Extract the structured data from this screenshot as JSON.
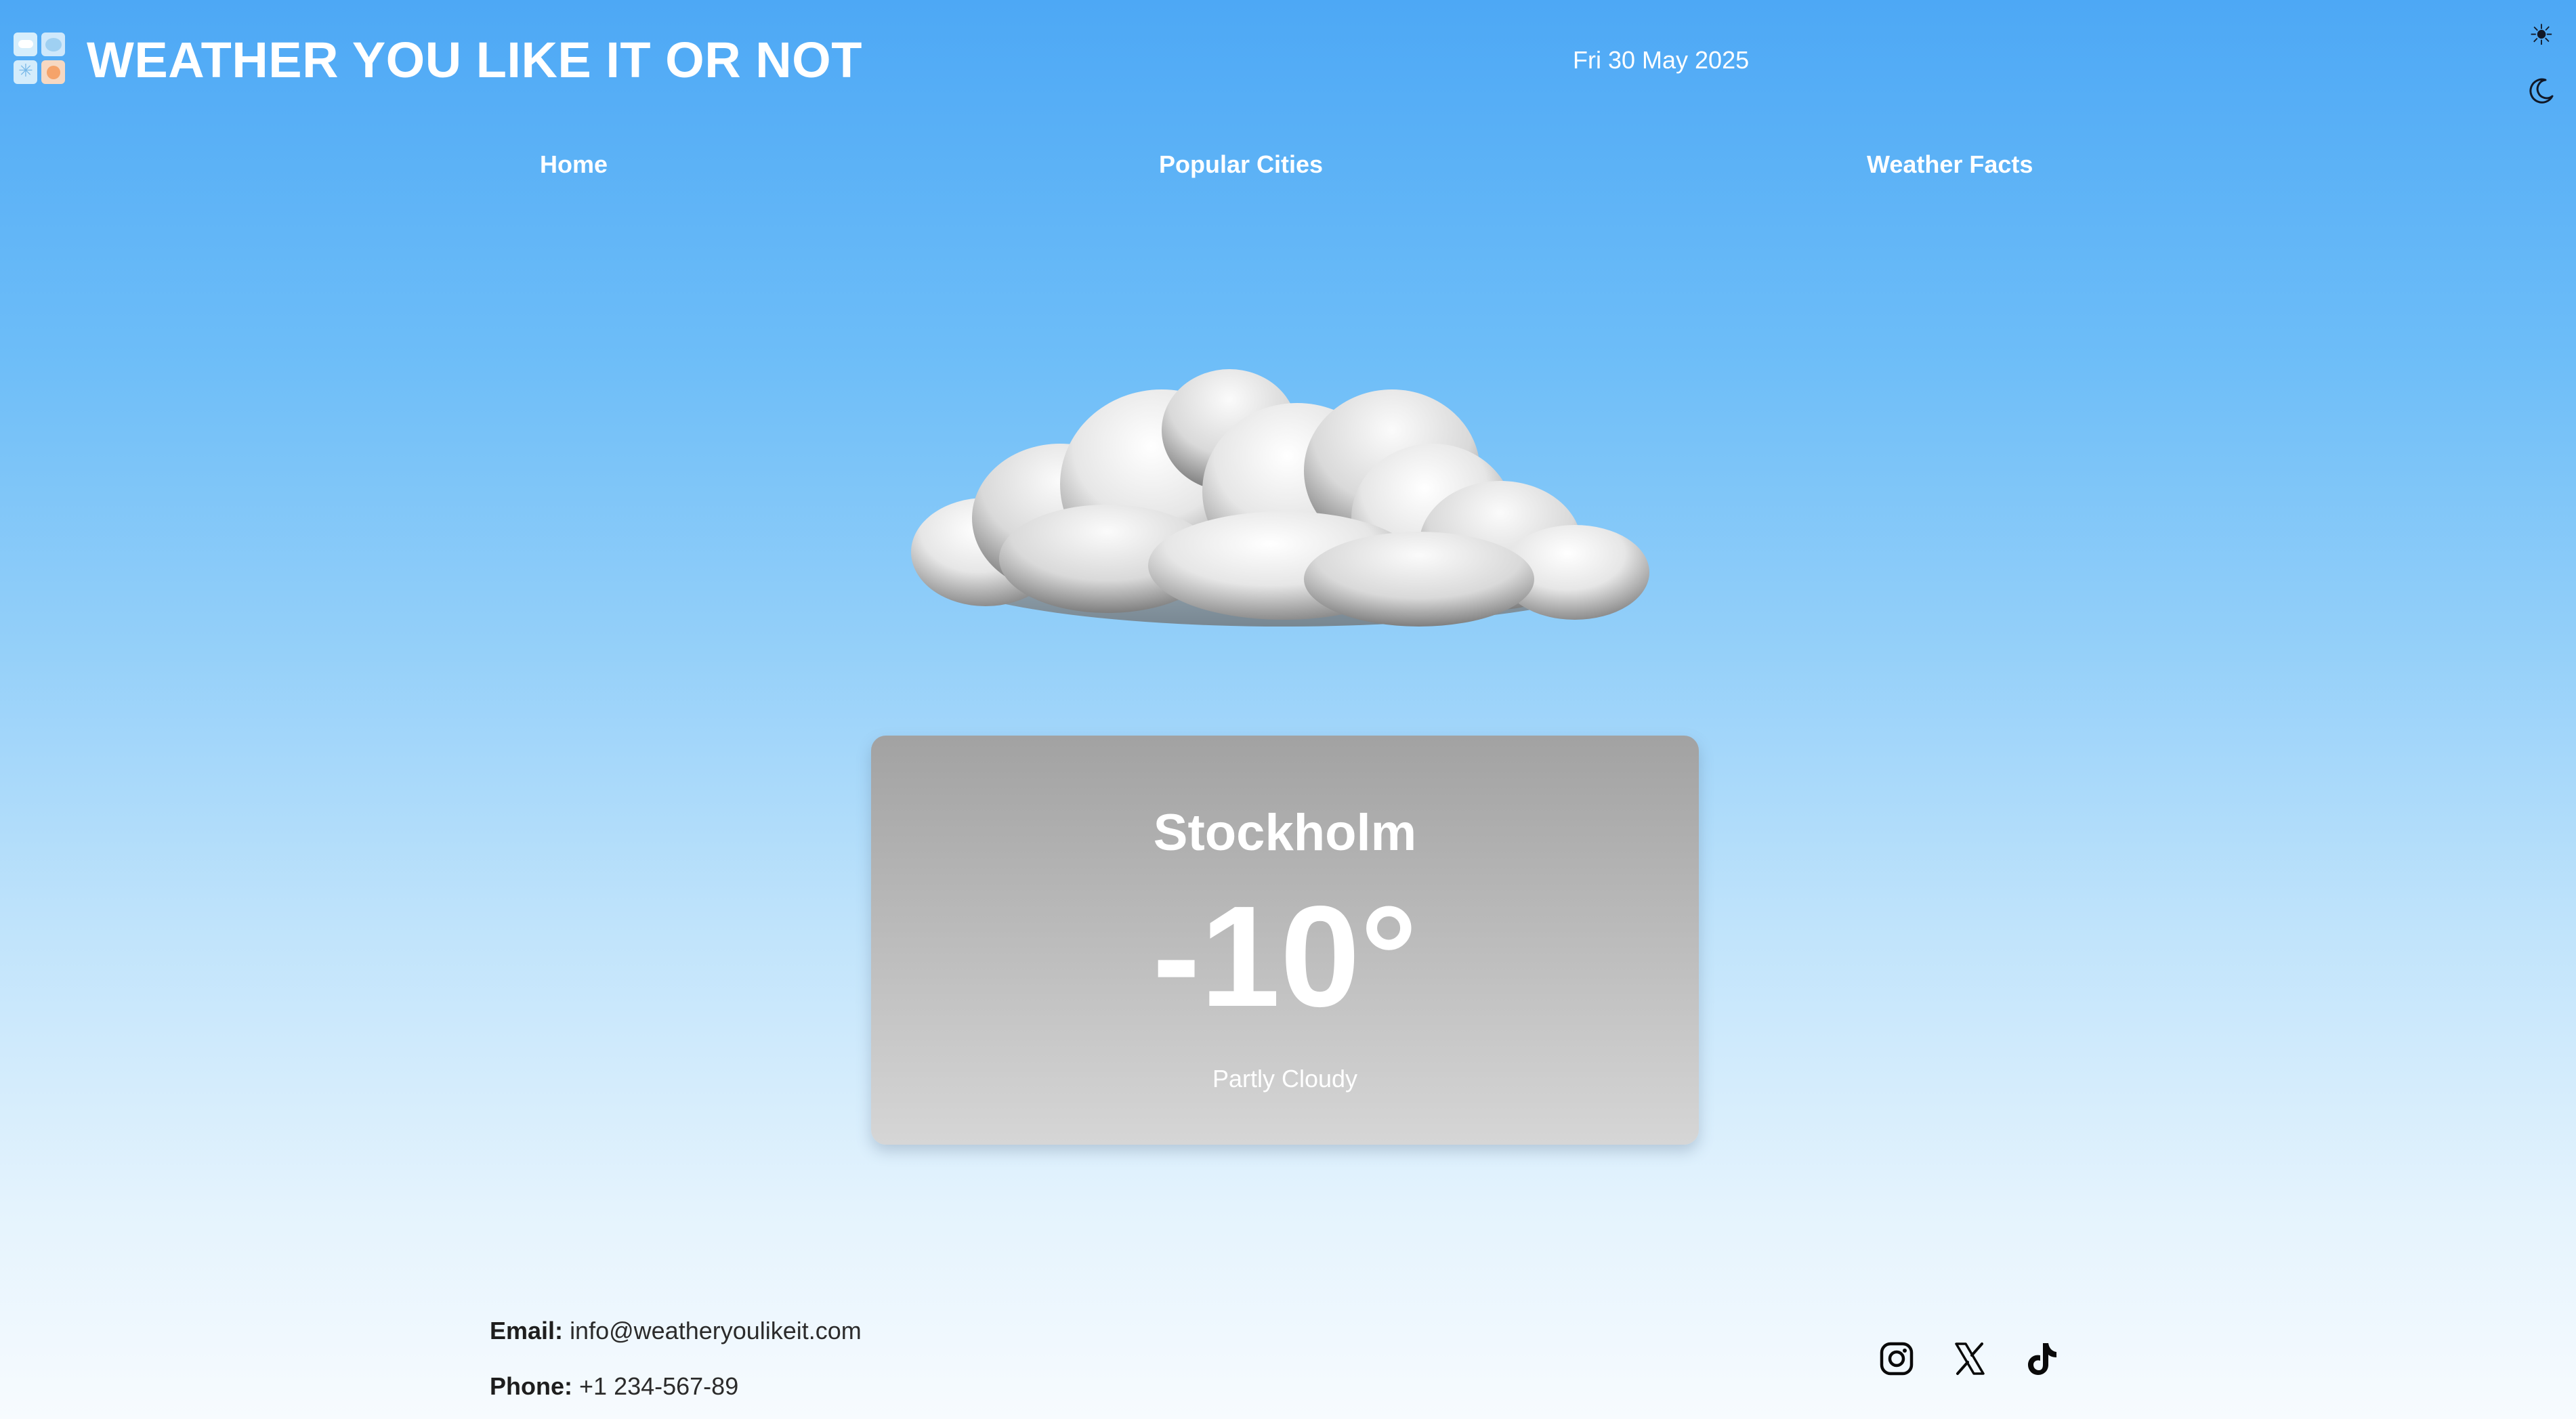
{
  "header": {
    "site_title": "WEATHER YOU LIKE IT OR NOT",
    "date": "Fri 30 May 2025",
    "logo_icon": "weather-app-logo-icon",
    "theme_toggle": {
      "light_icon": "sun-icon",
      "dark_icon": "moon-icon"
    }
  },
  "nav": {
    "items": [
      {
        "label": "Home"
      },
      {
        "label": "Popular Cities"
      },
      {
        "label": "Weather Facts"
      }
    ]
  },
  "weather": {
    "illustration_icon": "cloud-icon",
    "city": "Stockholm",
    "temperature": "-10°",
    "condition": "Partly Cloudy"
  },
  "footer": {
    "email_label": "Email:",
    "email_value": "info@weatheryoulikeit.com",
    "phone_label": "Phone:",
    "phone_value": "+1 234-567-89",
    "socials": [
      {
        "icon": "instagram-icon"
      },
      {
        "icon": "x-icon"
      },
      {
        "icon": "tiktok-icon"
      }
    ]
  },
  "colors": {
    "sky_top": "#4da8f5",
    "sky_bottom": "#f7fbfe",
    "card_top": "#a2a2a2",
    "card_bottom": "#d6d6d6",
    "text_light": "#ffffff",
    "text_dark": "#2b2b2b"
  }
}
